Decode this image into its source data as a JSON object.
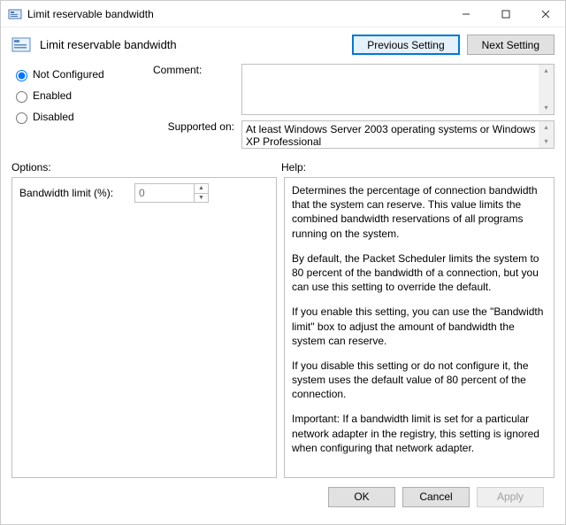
{
  "window": {
    "title": "Limit reservable bandwidth"
  },
  "header": {
    "title": "Limit reservable bandwidth",
    "prev_btn": "Previous Setting",
    "next_btn": "Next Setting"
  },
  "radios": {
    "not_configured": "Not Configured",
    "enabled": "Enabled",
    "disabled": "Disabled"
  },
  "labels": {
    "comment": "Comment:",
    "supported_on": "Supported on:",
    "options": "Options:",
    "help": "Help:"
  },
  "supported_text": "At least Windows Server 2003 operating systems or Windows XP Professional",
  "options": {
    "bandwidth_label": "Bandwidth limit (%):",
    "bandwidth_value": "0"
  },
  "help": {
    "p1": "Determines the percentage of connection bandwidth that the system can reserve. This value limits the combined bandwidth reservations of all programs running on the system.",
    "p2": "By default, the Packet Scheduler limits the system to 80 percent of the bandwidth of a connection, but you can use this setting to override the default.",
    "p3": "If you enable this setting, you can use the \"Bandwidth limit\" box to adjust the amount of bandwidth the system can reserve.",
    "p4": "If you disable this setting or do not configure it, the system uses the default value of 80 percent of the connection.",
    "p5": "Important: If a bandwidth limit is set for a particular network adapter in the registry, this setting is ignored when configuring that network adapter."
  },
  "footer": {
    "ok": "OK",
    "cancel": "Cancel",
    "apply": "Apply"
  }
}
